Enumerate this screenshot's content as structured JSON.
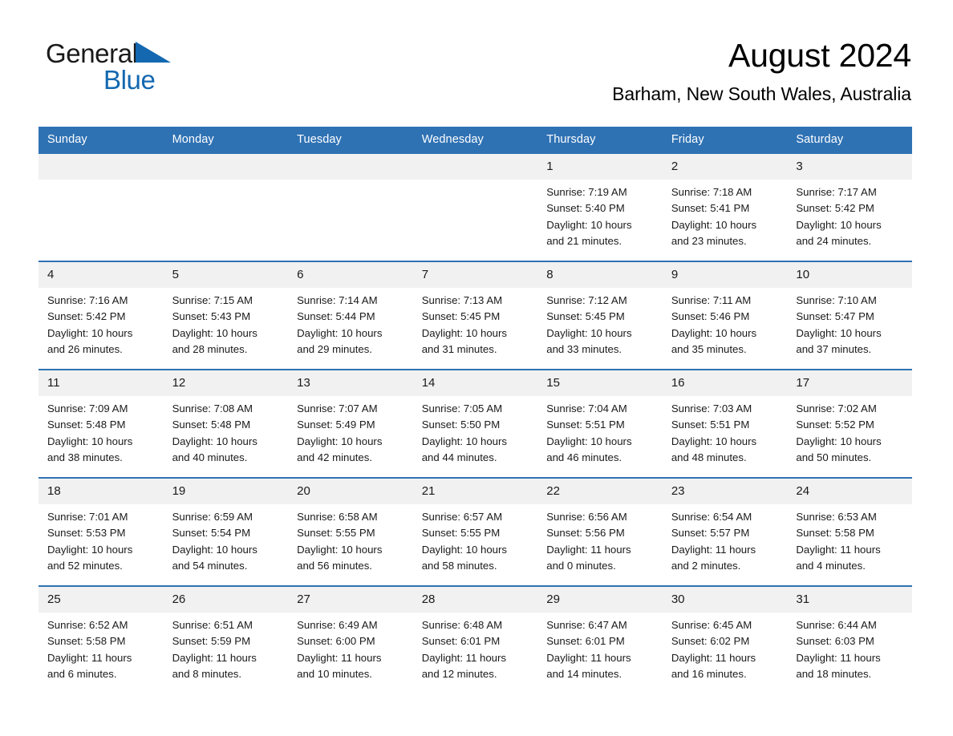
{
  "brand": {
    "name_part1": "General",
    "name_part2": "Blue",
    "triangle_color": "#1368b0"
  },
  "header": {
    "title": "August 2024",
    "subtitle": "Barham, New South Wales, Australia"
  },
  "theme": {
    "header_blue": "#2f72b4",
    "daynum_band": "#f1f1f1",
    "page_background": "#ffffff",
    "text": "#1a1a1a"
  },
  "weekday_headers": [
    "Sunday",
    "Monday",
    "Tuesday",
    "Wednesday",
    "Thursday",
    "Friday",
    "Saturday"
  ],
  "weeks": [
    [
      {
        "date": "",
        "sunrise": "",
        "sunset": "",
        "daylight_line1": "",
        "daylight_line2": ""
      },
      {
        "date": "",
        "sunrise": "",
        "sunset": "",
        "daylight_line1": "",
        "daylight_line2": ""
      },
      {
        "date": "",
        "sunrise": "",
        "sunset": "",
        "daylight_line1": "",
        "daylight_line2": ""
      },
      {
        "date": "",
        "sunrise": "",
        "sunset": "",
        "daylight_line1": "",
        "daylight_line2": ""
      },
      {
        "date": "1",
        "sunrise": "Sunrise: 7:19 AM",
        "sunset": "Sunset: 5:40 PM",
        "daylight_line1": "Daylight: 10 hours",
        "daylight_line2": "and 21 minutes."
      },
      {
        "date": "2",
        "sunrise": "Sunrise: 7:18 AM",
        "sunset": "Sunset: 5:41 PM",
        "daylight_line1": "Daylight: 10 hours",
        "daylight_line2": "and 23 minutes."
      },
      {
        "date": "3",
        "sunrise": "Sunrise: 7:17 AM",
        "sunset": "Sunset: 5:42 PM",
        "daylight_line1": "Daylight: 10 hours",
        "daylight_line2": "and 24 minutes."
      }
    ],
    [
      {
        "date": "4",
        "sunrise": "Sunrise: 7:16 AM",
        "sunset": "Sunset: 5:42 PM",
        "daylight_line1": "Daylight: 10 hours",
        "daylight_line2": "and 26 minutes."
      },
      {
        "date": "5",
        "sunrise": "Sunrise: 7:15 AM",
        "sunset": "Sunset: 5:43 PM",
        "daylight_line1": "Daylight: 10 hours",
        "daylight_line2": "and 28 minutes."
      },
      {
        "date": "6",
        "sunrise": "Sunrise: 7:14 AM",
        "sunset": "Sunset: 5:44 PM",
        "daylight_line1": "Daylight: 10 hours",
        "daylight_line2": "and 29 minutes."
      },
      {
        "date": "7",
        "sunrise": "Sunrise: 7:13 AM",
        "sunset": "Sunset: 5:45 PM",
        "daylight_line1": "Daylight: 10 hours",
        "daylight_line2": "and 31 minutes."
      },
      {
        "date": "8",
        "sunrise": "Sunrise: 7:12 AM",
        "sunset": "Sunset: 5:45 PM",
        "daylight_line1": "Daylight: 10 hours",
        "daylight_line2": "and 33 minutes."
      },
      {
        "date": "9",
        "sunrise": "Sunrise: 7:11 AM",
        "sunset": "Sunset: 5:46 PM",
        "daylight_line1": "Daylight: 10 hours",
        "daylight_line2": "and 35 minutes."
      },
      {
        "date": "10",
        "sunrise": "Sunrise: 7:10 AM",
        "sunset": "Sunset: 5:47 PM",
        "daylight_line1": "Daylight: 10 hours",
        "daylight_line2": "and 37 minutes."
      }
    ],
    [
      {
        "date": "11",
        "sunrise": "Sunrise: 7:09 AM",
        "sunset": "Sunset: 5:48 PM",
        "daylight_line1": "Daylight: 10 hours",
        "daylight_line2": "and 38 minutes."
      },
      {
        "date": "12",
        "sunrise": "Sunrise: 7:08 AM",
        "sunset": "Sunset: 5:48 PM",
        "daylight_line1": "Daylight: 10 hours",
        "daylight_line2": "and 40 minutes."
      },
      {
        "date": "13",
        "sunrise": "Sunrise: 7:07 AM",
        "sunset": "Sunset: 5:49 PM",
        "daylight_line1": "Daylight: 10 hours",
        "daylight_line2": "and 42 minutes."
      },
      {
        "date": "14",
        "sunrise": "Sunrise: 7:05 AM",
        "sunset": "Sunset: 5:50 PM",
        "daylight_line1": "Daylight: 10 hours",
        "daylight_line2": "and 44 minutes."
      },
      {
        "date": "15",
        "sunrise": "Sunrise: 7:04 AM",
        "sunset": "Sunset: 5:51 PM",
        "daylight_line1": "Daylight: 10 hours",
        "daylight_line2": "and 46 minutes."
      },
      {
        "date": "16",
        "sunrise": "Sunrise: 7:03 AM",
        "sunset": "Sunset: 5:51 PM",
        "daylight_line1": "Daylight: 10 hours",
        "daylight_line2": "and 48 minutes."
      },
      {
        "date": "17",
        "sunrise": "Sunrise: 7:02 AM",
        "sunset": "Sunset: 5:52 PM",
        "daylight_line1": "Daylight: 10 hours",
        "daylight_line2": "and 50 minutes."
      }
    ],
    [
      {
        "date": "18",
        "sunrise": "Sunrise: 7:01 AM",
        "sunset": "Sunset: 5:53 PM",
        "daylight_line1": "Daylight: 10 hours",
        "daylight_line2": "and 52 minutes."
      },
      {
        "date": "19",
        "sunrise": "Sunrise: 6:59 AM",
        "sunset": "Sunset: 5:54 PM",
        "daylight_line1": "Daylight: 10 hours",
        "daylight_line2": "and 54 minutes."
      },
      {
        "date": "20",
        "sunrise": "Sunrise: 6:58 AM",
        "sunset": "Sunset: 5:55 PM",
        "daylight_line1": "Daylight: 10 hours",
        "daylight_line2": "and 56 minutes."
      },
      {
        "date": "21",
        "sunrise": "Sunrise: 6:57 AM",
        "sunset": "Sunset: 5:55 PM",
        "daylight_line1": "Daylight: 10 hours",
        "daylight_line2": "and 58 minutes."
      },
      {
        "date": "22",
        "sunrise": "Sunrise: 6:56 AM",
        "sunset": "Sunset: 5:56 PM",
        "daylight_line1": "Daylight: 11 hours",
        "daylight_line2": "and 0 minutes."
      },
      {
        "date": "23",
        "sunrise": "Sunrise: 6:54 AM",
        "sunset": "Sunset: 5:57 PM",
        "daylight_line1": "Daylight: 11 hours",
        "daylight_line2": "and 2 minutes."
      },
      {
        "date": "24",
        "sunrise": "Sunrise: 6:53 AM",
        "sunset": "Sunset: 5:58 PM",
        "daylight_line1": "Daylight: 11 hours",
        "daylight_line2": "and 4 minutes."
      }
    ],
    [
      {
        "date": "25",
        "sunrise": "Sunrise: 6:52 AM",
        "sunset": "Sunset: 5:58 PM",
        "daylight_line1": "Daylight: 11 hours",
        "daylight_line2": "and 6 minutes."
      },
      {
        "date": "26",
        "sunrise": "Sunrise: 6:51 AM",
        "sunset": "Sunset: 5:59 PM",
        "daylight_line1": "Daylight: 11 hours",
        "daylight_line2": "and 8 minutes."
      },
      {
        "date": "27",
        "sunrise": "Sunrise: 6:49 AM",
        "sunset": "Sunset: 6:00 PM",
        "daylight_line1": "Daylight: 11 hours",
        "daylight_line2": "and 10 minutes."
      },
      {
        "date": "28",
        "sunrise": "Sunrise: 6:48 AM",
        "sunset": "Sunset: 6:01 PM",
        "daylight_line1": "Daylight: 11 hours",
        "daylight_line2": "and 12 minutes."
      },
      {
        "date": "29",
        "sunrise": "Sunrise: 6:47 AM",
        "sunset": "Sunset: 6:01 PM",
        "daylight_line1": "Daylight: 11 hours",
        "daylight_line2": "and 14 minutes."
      },
      {
        "date": "30",
        "sunrise": "Sunrise: 6:45 AM",
        "sunset": "Sunset: 6:02 PM",
        "daylight_line1": "Daylight: 11 hours",
        "daylight_line2": "and 16 minutes."
      },
      {
        "date": "31",
        "sunrise": "Sunrise: 6:44 AM",
        "sunset": "Sunset: 6:03 PM",
        "daylight_line1": "Daylight: 11 hours",
        "daylight_line2": "and 18 minutes."
      }
    ]
  ]
}
